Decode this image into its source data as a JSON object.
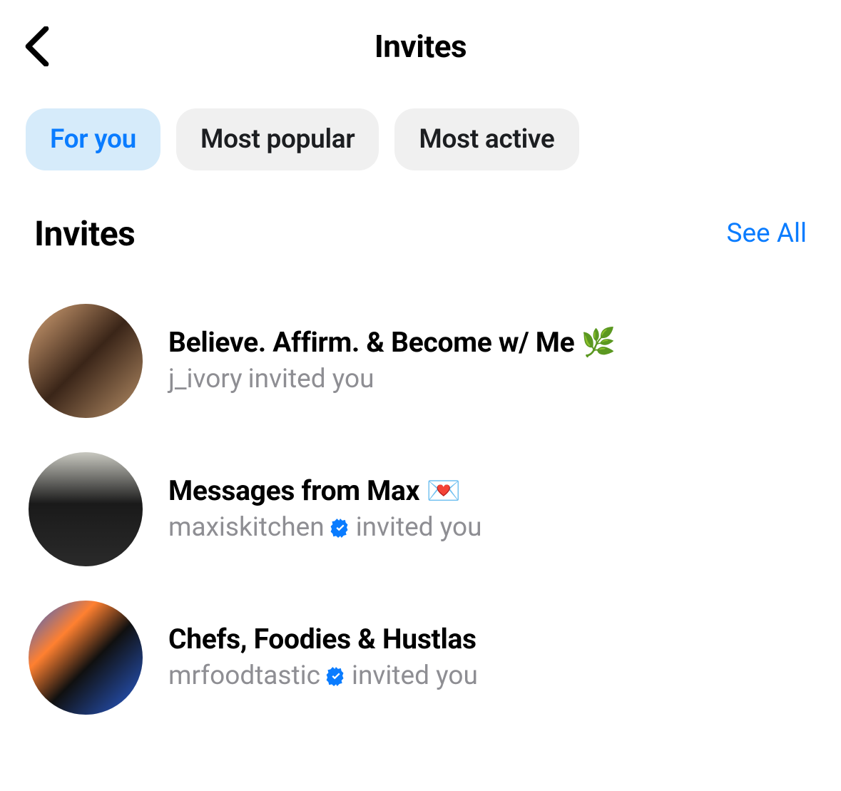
{
  "header": {
    "title": "Invites"
  },
  "tabs": [
    {
      "label": "For you",
      "active": true
    },
    {
      "label": "Most popular",
      "active": false
    },
    {
      "label": "Most active",
      "active": false
    }
  ],
  "section": {
    "title": "Invites",
    "see_all_label": "See All"
  },
  "invites": [
    {
      "title": "Believe. Affirm. & Become w/ Me 🌿",
      "username": "j_ivory",
      "verified": false,
      "suffix": "invited you"
    },
    {
      "title": "Messages from Max 💌",
      "username": "maxiskitchen",
      "verified": true,
      "suffix": "invited you"
    },
    {
      "title": "Chefs, Foodies & Hustlas",
      "username": "mrfoodtastic",
      "verified": true,
      "suffix": "invited you"
    }
  ]
}
